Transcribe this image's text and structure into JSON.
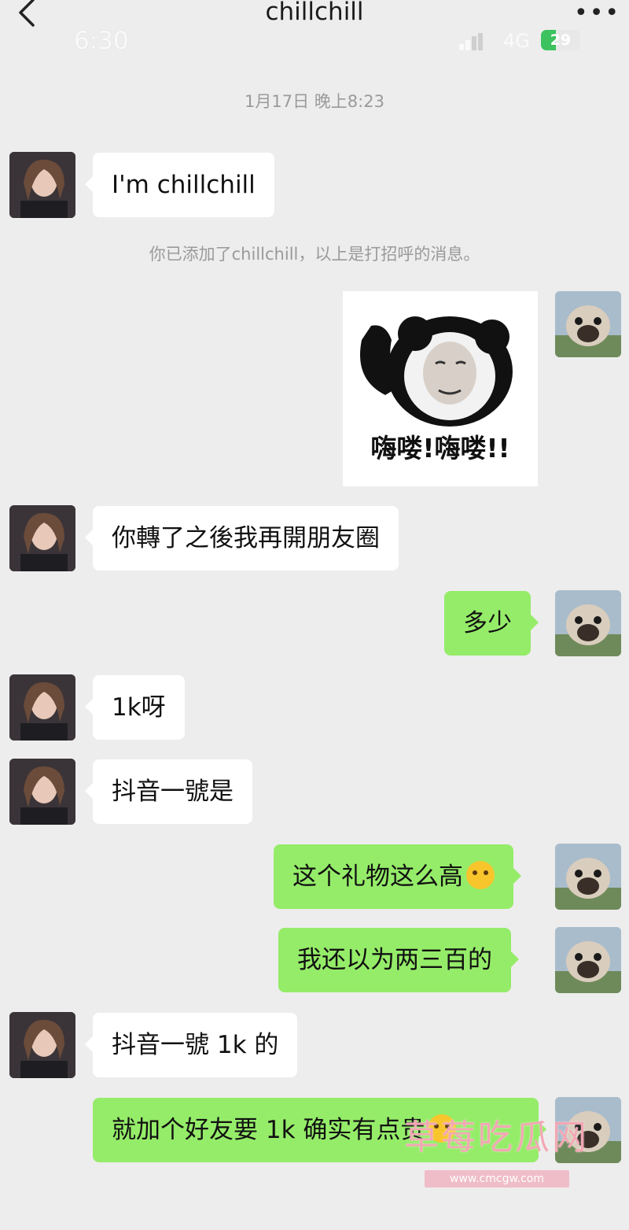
{
  "header": {
    "title": "chillchill",
    "back_icon": "chevron-left-icon",
    "more_icon": "more-dots-icon",
    "more_label": "•••"
  },
  "status_bar": {
    "time": "6:30",
    "network": "4G",
    "battery": "29",
    "signal_icon": "signal-bars-icon"
  },
  "timestamp": "1月17日 晚上8:23",
  "system_notice": "你已添加了chillchill，以上是打招呼的消息。",
  "messages": [
    {
      "side": "in",
      "text": "I'm chillchill"
    },
    {
      "side": "out",
      "type": "sticker",
      "text": "嗨喽!嗨喽!!"
    },
    {
      "side": "in",
      "text": "你轉了之後我再開朋友圈"
    },
    {
      "side": "out",
      "text": "多少"
    },
    {
      "side": "in",
      "text": "1k呀"
    },
    {
      "side": "in",
      "text": "抖音一號是"
    },
    {
      "side": "out",
      "text": "这个礼物这么高",
      "emoji": "laughing-crying-emoji"
    },
    {
      "side": "out",
      "text": "我还以为两三百的"
    },
    {
      "side": "in",
      "text": "抖音一號 1k 的"
    },
    {
      "side": "out",
      "text": "就加个好友要 1k  确实有点贵",
      "emoji": "smiling-emoji"
    }
  ],
  "watermark": {
    "main": "草莓吃瓜网",
    "sub": "www.cmcgw.com"
  },
  "colors": {
    "outgoing_bubble": "#95ec69",
    "incoming_bubble": "#ffffff",
    "background": "#ededed"
  }
}
